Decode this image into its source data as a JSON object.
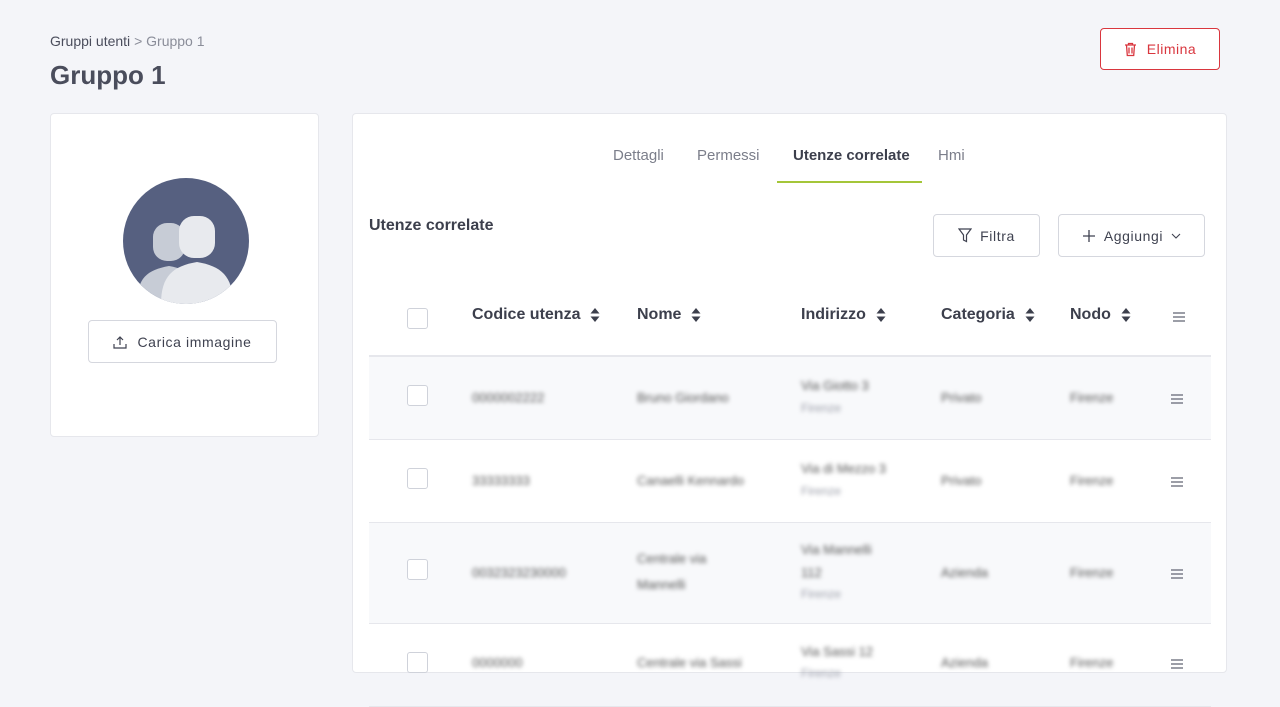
{
  "breadcrumb": {
    "parent": "Gruppi utenti",
    "separator": ">",
    "current": "Gruppo 1"
  },
  "page": {
    "title": "Gruppo 1"
  },
  "actions": {
    "delete_label": "Elimina",
    "delete_color": "#d9363e"
  },
  "profile": {
    "upload_label": "Carica immagine",
    "avatar_color": "#566080"
  },
  "tabs": [
    {
      "label": "Dettagli",
      "active": false
    },
    {
      "label": "Permessi",
      "active": false
    },
    {
      "label": "Utenze correlate",
      "active": true
    },
    {
      "label": "Hmi",
      "active": false
    }
  ],
  "accent_color": "#a4c639",
  "section": {
    "title": "Utenze correlate",
    "filter_label": "Filtra",
    "add_label": "Aggiungi"
  },
  "table": {
    "columns": [
      "Codice utenza",
      "Nome",
      "Indirizzo",
      "Categoria",
      "Nodo"
    ],
    "rows": [
      {
        "code": "0000002222",
        "name": "Bruno Giordano",
        "address": "Via Giotto 3",
        "address_sub": "Firenze",
        "category": "Privato",
        "node": "Firenze"
      },
      {
        "code": "33333333",
        "name": "Canaelli Kennardo",
        "address": "Via di Mezzo 3",
        "address_sub": "Firenze",
        "category": "Privato",
        "node": "Firenze"
      },
      {
        "code": "0032323230000",
        "name": "Centrale via",
        "name_line2": "Mannelli",
        "address": "Via Mannelli",
        "address_line2": "112",
        "address_sub": "Firenze",
        "category": "Azienda",
        "node": "Firenze"
      },
      {
        "code": "0000000",
        "name": "Centrale via Sassi",
        "address": "Via Sassi 12",
        "address_sub": "Firenze",
        "category": "Azienda",
        "node": "Firenze"
      }
    ]
  }
}
